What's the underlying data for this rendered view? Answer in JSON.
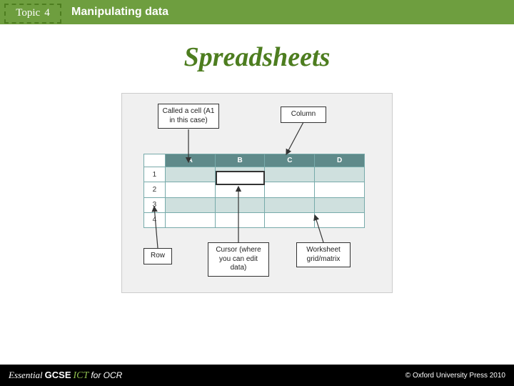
{
  "header": {
    "topic_word": "Topic",
    "topic_num": "4",
    "chapter": "Manipulating data"
  },
  "title": "Spreadsheets",
  "tags": {
    "cell": "Called a cell (A1 in this case)",
    "column": "Column",
    "row": "Row",
    "cursor": "Cursor (where you can edit data)",
    "matrix": "Worksheet grid/matrix"
  },
  "grid": {
    "cols": [
      "A",
      "B",
      "C",
      "D"
    ],
    "rows": [
      "1",
      "2",
      "3",
      "4"
    ]
  },
  "footer": {
    "brand_e": "Essential",
    "brand_g": "GCSE",
    "brand_i": "ICT",
    "brand_o": "for OCR",
    "copy": "© Oxford University Press 2010"
  }
}
